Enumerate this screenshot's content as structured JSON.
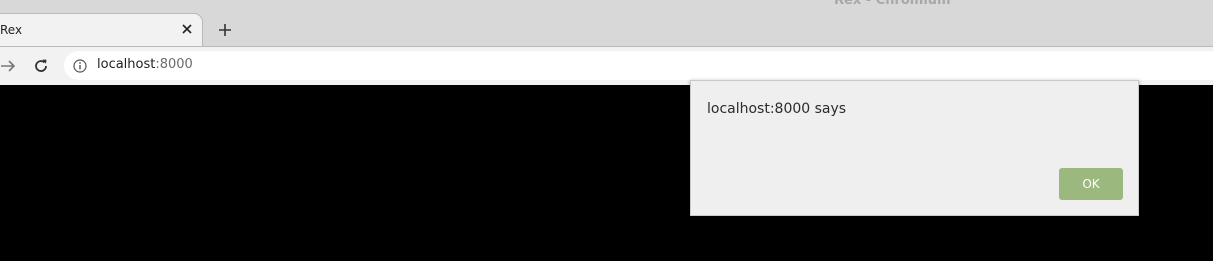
{
  "window": {
    "title": "Rex - Chromium"
  },
  "tabs": [
    {
      "title": "Rex",
      "close_icon": "close-icon"
    }
  ],
  "toolbar": {
    "new_tab_icon": "plus-icon",
    "forward_icon": "arrow-right-icon",
    "reload_icon": "reload-icon",
    "site_info_icon": "info-icon",
    "url_host": "localhost",
    "url_port": ":8000"
  },
  "dialog": {
    "message": "localhost:8000 says",
    "ok_label": "OK"
  },
  "colors": {
    "tabstrip": "#d8d8d8",
    "toolbar": "#f2f2f2",
    "page_background": "#000000",
    "dialog_background": "#efefef",
    "ok_button": "#9bb87f"
  }
}
